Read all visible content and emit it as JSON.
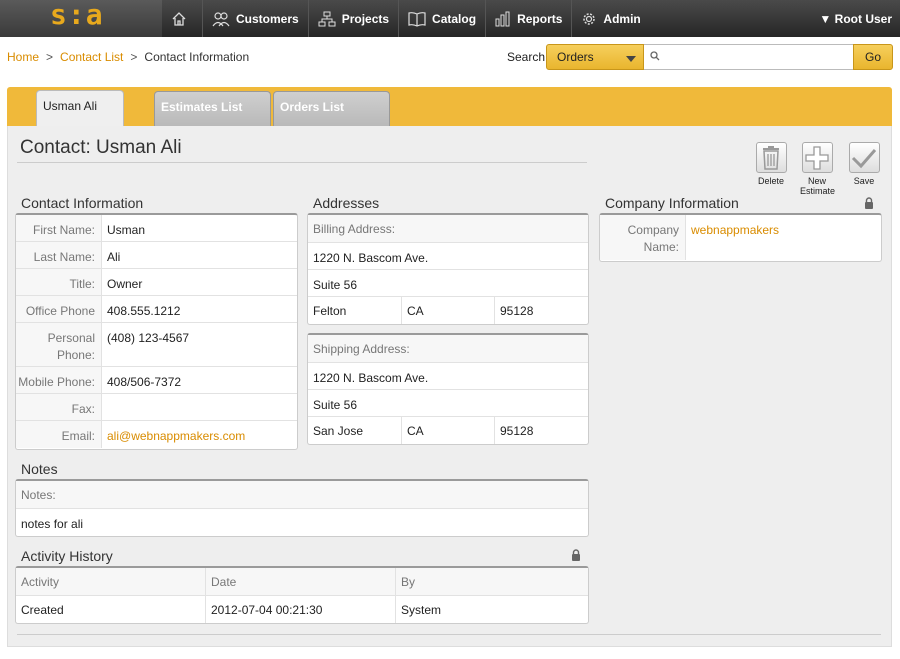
{
  "logo": {
    "text": "s:a"
  },
  "nav": {
    "home_icon": "home-icon",
    "items": [
      {
        "label": "Customers",
        "icon": "people-icon"
      },
      {
        "label": "Projects",
        "icon": "sitemap-icon"
      },
      {
        "label": "Catalog",
        "icon": "book-icon"
      },
      {
        "label": "Reports",
        "icon": "bar-chart-icon"
      },
      {
        "label": "Admin",
        "icon": "gear-icon"
      }
    ],
    "user": "Root User"
  },
  "breadcrumb": {
    "home": "Home",
    "list": "Contact List",
    "current": "Contact Information",
    "sep": ">"
  },
  "search": {
    "label": "Search",
    "selected": "Orders",
    "value": "",
    "go": "Go"
  },
  "tabs": [
    "Usman Ali",
    "Estimates List",
    "Orders List"
  ],
  "title": "Contact: Usman Ali",
  "actions": {
    "delete": "Delete",
    "new_line1": "New",
    "new_line2": "Estimate",
    "save": "Save"
  },
  "contact": {
    "heading": "Contact Information",
    "fields": [
      {
        "label": "First Name:",
        "value": "Usman"
      },
      {
        "label": "Last Name:",
        "value": "Ali"
      },
      {
        "label": "Title:",
        "value": "Owner"
      },
      {
        "label": "Office Phone",
        "value": "408.555.1212"
      },
      {
        "label": "Personal",
        "label2": "Phone:",
        "value": "(408) 123-4567"
      },
      {
        "label": "Mobile Phone:",
        "value": "408/506-7372"
      },
      {
        "label": "Fax:",
        "value": ""
      },
      {
        "label": "Email:",
        "value": "ali@webnappmakers.com"
      }
    ]
  },
  "addresses": {
    "heading": "Addresses",
    "billing": {
      "label": "Billing Address:",
      "line1": "1220 N. Bascom Ave.",
      "line2": "Suite 56",
      "city": "Felton",
      "state": "CA",
      "zip": "95128"
    },
    "shipping": {
      "label": "Shipping Address:",
      "line1": "1220 N. Bascom Ave.",
      "line2": "Suite 56",
      "city": "San Jose",
      "state": "CA",
      "zip": "95128"
    }
  },
  "company": {
    "heading": "Company Information",
    "label1": "Company",
    "label2": "Name:",
    "value": "webnappmakers"
  },
  "notes": {
    "heading": "Notes",
    "label": "Notes:",
    "value": "notes for ali"
  },
  "activity": {
    "heading": "Activity History",
    "columns": [
      "Activity",
      "Date",
      "By"
    ],
    "rows": [
      [
        "Created",
        "2012-07-04 00:21:30",
        "System"
      ]
    ]
  },
  "colors": {
    "accent": "#f0b93a",
    "link": "#d98c00",
    "topbar": "#2e2e2e"
  }
}
